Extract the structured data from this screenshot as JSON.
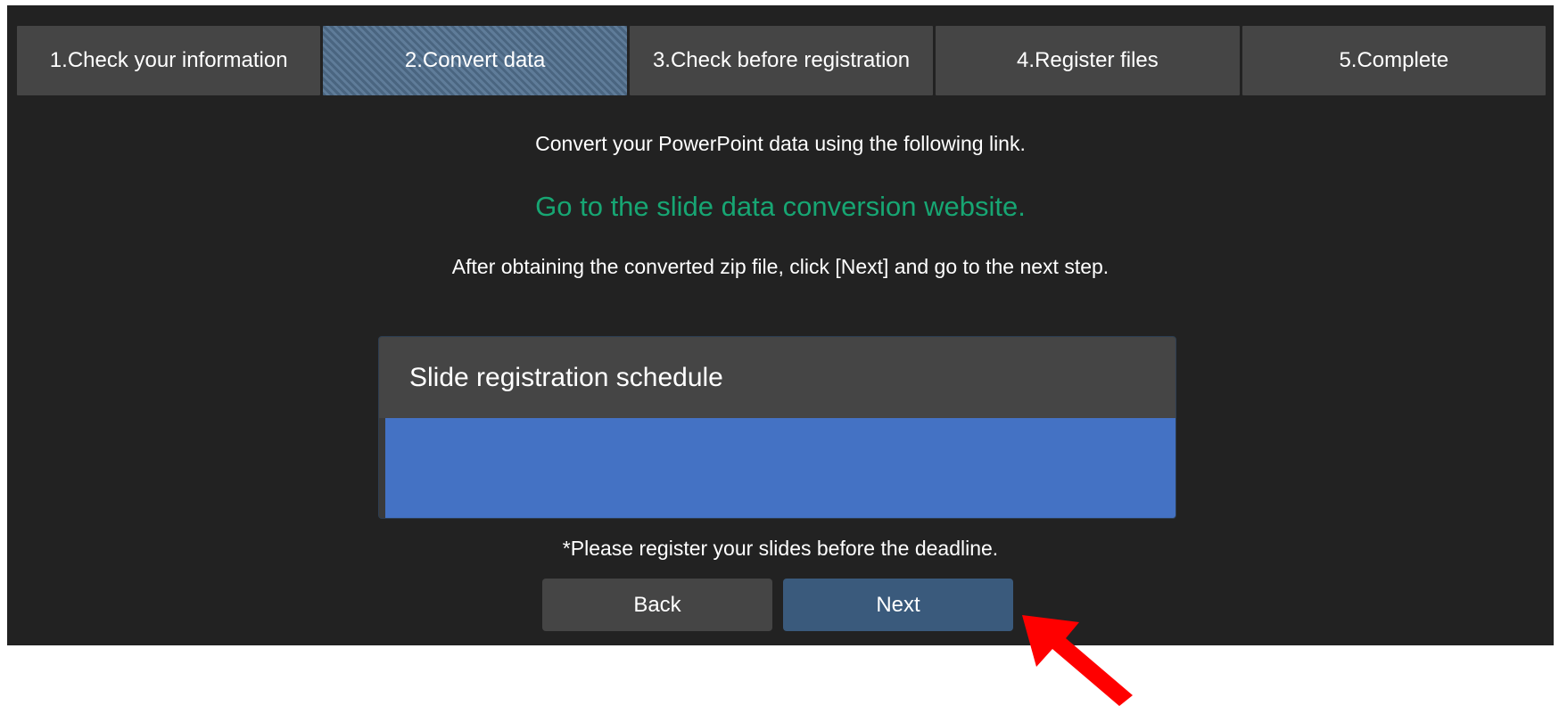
{
  "stepper": {
    "steps": [
      {
        "label": "1.Check your information",
        "active": false
      },
      {
        "label": "2.Convert data",
        "active": true
      },
      {
        "label": "3.Check before registration",
        "active": false
      },
      {
        "label": "4.Register files",
        "active": false
      },
      {
        "label": "5.Complete",
        "active": false
      }
    ]
  },
  "content": {
    "intro": "Convert your PowerPoint data using the following link.",
    "link_text": "Go to the slide data conversion website.",
    "after_text": "After obtaining the converted zip file, click [Next] and go to the next step.",
    "deadline_note": "*Please register your slides before the deadline."
  },
  "schedule": {
    "title": "Slide registration schedule"
  },
  "buttons": {
    "back": "Back",
    "next": "Next"
  },
  "colors": {
    "background": "#222222",
    "step_bg": "#454545",
    "link": "#17a673",
    "schedule_body": "#4472c4",
    "next_button": "#3a5a7c",
    "annotation_arrow": "#ff0000"
  },
  "icons": {
    "annotation": "red-arrow-pointing-to-next"
  }
}
